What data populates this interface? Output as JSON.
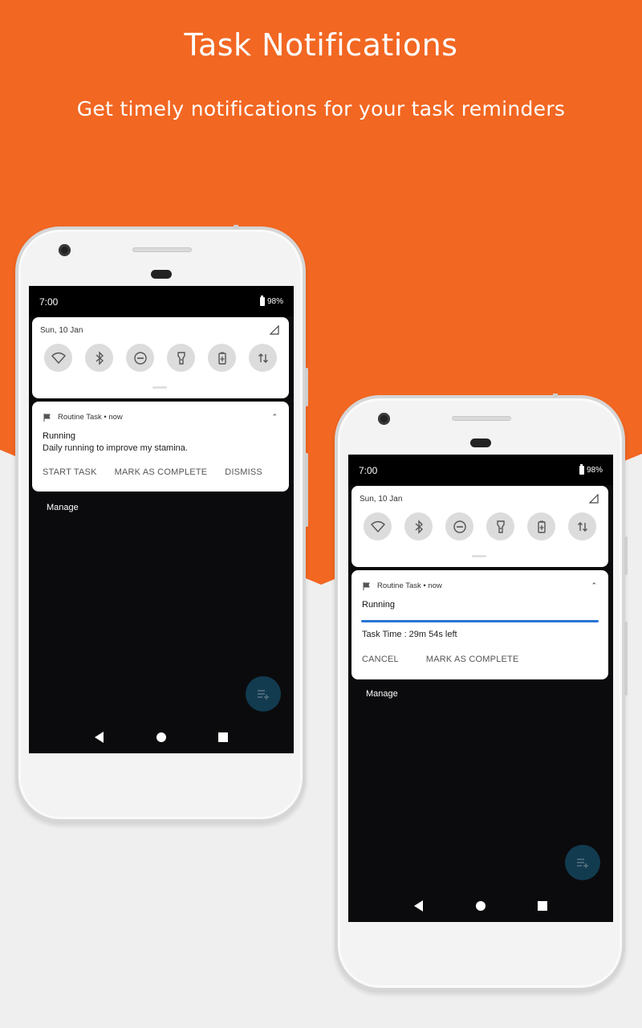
{
  "header": {
    "title": "Task Notifications",
    "subtitle": "Get timely notifications for your task reminders"
  },
  "colors": {
    "brand_orange": "#f26722",
    "progress_blue": "#2a74d6",
    "fab": "#123b50"
  },
  "phones": [
    {
      "status": {
        "time": "7:00",
        "battery": "98%"
      },
      "quick_settings": {
        "date": "Sun, 10 Jan",
        "tiles": [
          "wifi-icon",
          "bluetooth-icon",
          "do-not-disturb-icon",
          "flashlight-icon",
          "battery-saver-icon",
          "mobile-data-icon"
        ]
      },
      "notification": {
        "app": "Routine Task",
        "time": "now",
        "header": "Routine Task • now",
        "title": "Running",
        "text": "Daily running to improve my stamina.",
        "actions": [
          "START TASK",
          "MARK AS COMPLETE",
          "DISMISS"
        ]
      },
      "manage_label": "Manage"
    },
    {
      "status": {
        "time": "7:00",
        "battery": "98%"
      },
      "quick_settings": {
        "date": "Sun, 10 Jan",
        "tiles": [
          "wifi-icon",
          "bluetooth-icon",
          "do-not-disturb-icon",
          "flashlight-icon",
          "battery-saver-icon",
          "mobile-data-icon"
        ]
      },
      "notification": {
        "app": "Routine Task",
        "time": "now",
        "header": "Routine Task • now",
        "title": "Running",
        "progress_percent": 100,
        "text": "Task Time : 29m 54s  left",
        "actions": [
          "CANCEL",
          "MARK AS COMPLETE"
        ]
      },
      "manage_label": "Manage"
    }
  ]
}
